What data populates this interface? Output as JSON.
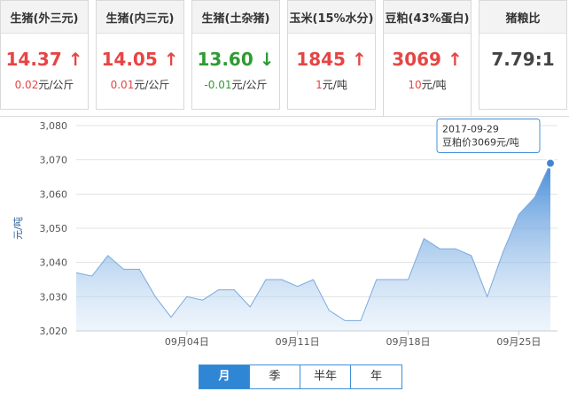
{
  "cards": [
    {
      "title": "生猪(外三元)",
      "value": "14.37",
      "arrow": "↑",
      "trend": "up",
      "change": "0.02",
      "unit": "元/公斤"
    },
    {
      "title": "生猪(内三元)",
      "value": "14.05",
      "arrow": "↑",
      "trend": "up",
      "change": "0.01",
      "unit": "元/公斤"
    },
    {
      "title": "生猪(土杂猪)",
      "value": "13.60",
      "arrow": "↓",
      "trend": "down",
      "change": "-0.01",
      "unit": "元/公斤"
    },
    {
      "title": "玉米(15%水分)",
      "value": "1845",
      "arrow": "↑",
      "trend": "up",
      "change": "1",
      "unit": "元/吨"
    },
    {
      "title": "豆粕(43%蛋白)",
      "value": "3069",
      "arrow": "↑",
      "trend": "up",
      "change": "10",
      "unit": "元/吨"
    },
    {
      "title": "猪粮比",
      "value": "7.79:1",
      "arrow": "",
      "trend": "neutral",
      "change": "",
      "unit": ""
    }
  ],
  "colors": {
    "up": "#e64545",
    "down": "#2e9b33",
    "line": "#4a90d9",
    "accent": "#2f86d4"
  },
  "tooltip": {
    "date": "2017-09-29",
    "text": "豆粕价3069元/吨"
  },
  "tabs": [
    "月",
    "季",
    "半年",
    "年"
  ],
  "chart_data": {
    "type": "area",
    "ylabel": "元/吨",
    "ylim": [
      3020,
      3080
    ],
    "yticks": [
      3020,
      3030,
      3040,
      3050,
      3060,
      3070,
      3080
    ],
    "ytick_labels": [
      "3,020",
      "3,030",
      "3,040",
      "3,050",
      "3,060",
      "3,070",
      "3,080"
    ],
    "xtick_labels": [
      "09月04日",
      "09月11日",
      "09月18日",
      "09月25日"
    ],
    "xtick_index": [
      7,
      14,
      21,
      28
    ],
    "grid": true,
    "series": [
      {
        "values": [
          3037,
          3036,
          3042,
          3038,
          3038,
          3030,
          3024,
          3030,
          3029,
          3032,
          3032,
          3027,
          3035,
          3035,
          3033,
          3035,
          3026,
          3023,
          3023,
          3035,
          3035,
          3035,
          3047,
          3044,
          3044,
          3042,
          3030,
          3043,
          3054,
          3059,
          3069
        ]
      }
    ],
    "x_start": "2017-08-28",
    "x_end": "2017-09-29"
  }
}
